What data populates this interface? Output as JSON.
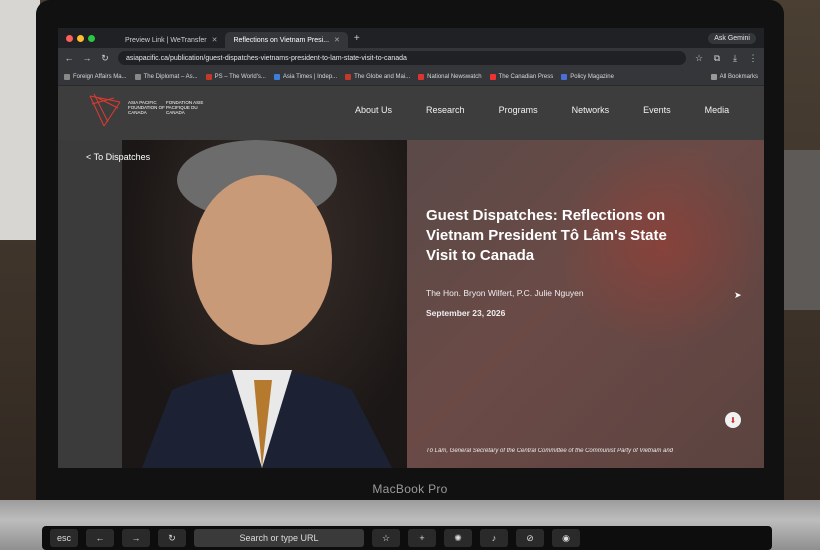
{
  "device": {
    "bezel_label": "MacBook Pro"
  },
  "browser": {
    "tabs": [
      {
        "label": "Preview Link | WeTransfer",
        "active": false
      },
      {
        "label": "Reflections on Vietnam Presi...",
        "active": true
      }
    ],
    "ask_gemini": "Ask Gemini",
    "url": "asiapacific.ca/publication/guest-dispatches-vietnams-president-to-lam-state-visit-to-canada",
    "bookmarks": [
      "Foreign Affairs Ma...",
      "The Diplomat – As...",
      "PS – The World's...",
      "Asia Times | Indep...",
      "The Globe and Mai...",
      "National Newswatch",
      "The Canadian Press",
      "Policy Magazine"
    ],
    "all_bookmarks": "All Bookmarks"
  },
  "site": {
    "logo": {
      "en": "ASIA PACIFIC FOUNDATION OF CANADA",
      "fr": "FONDATION ASIE PACIFIQUE DU CANADA"
    },
    "nav": [
      "About Us",
      "Research",
      "Programs",
      "Networks",
      "Events",
      "Media"
    ]
  },
  "article": {
    "back_link": "< To Dispatches",
    "title": "Guest Dispatches: Reflections on Vietnam President Tô Lâm's State Visit to Canada",
    "authors": "The Hon. Bryon Wilfert, P.C.  Julie Nguyen",
    "date": "September 23, 2026",
    "caption": "Tô Lâm, General Secretary of the Central Committee of the Communist Party of Vietnam and"
  },
  "touchbar": {
    "esc": "esc",
    "search": "Search or type URL"
  },
  "colors": {
    "header_bg": "#3d3d3d",
    "hero_accent": "#6b4a46",
    "logo_red": "#e03a2f"
  }
}
